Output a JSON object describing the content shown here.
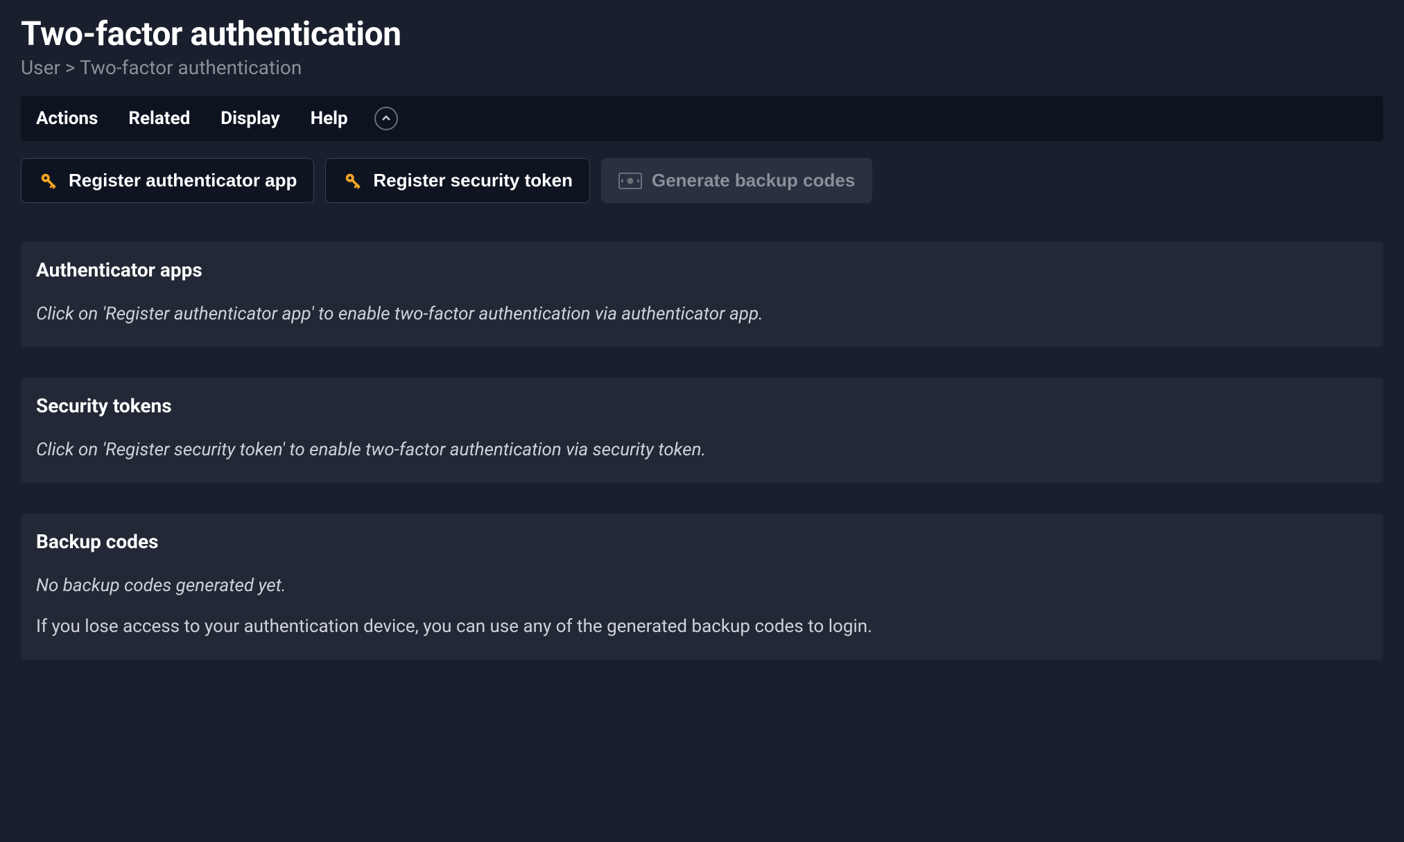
{
  "header": {
    "title": "Two-factor authentication",
    "breadcrumb_parent": "User",
    "breadcrumb_sep": " > ",
    "breadcrumb_current": "Two-factor authentication"
  },
  "menubar": {
    "items": [
      "Actions",
      "Related",
      "Display",
      "Help"
    ]
  },
  "actions": {
    "register_app": "Register authenticator app",
    "register_token": "Register security token",
    "generate_backup": "Generate backup codes"
  },
  "panels": {
    "authenticator": {
      "title": "Authenticator apps",
      "body": "Click on 'Register authenticator app' to enable two-factor authentication via authenticator app."
    },
    "tokens": {
      "title": "Security tokens",
      "body": "Click on 'Register security token' to enable two-factor authentication via security token."
    },
    "backup": {
      "title": "Backup codes",
      "none": "No backup codes generated yet.",
      "info": "If you lose access to your authentication device, you can use any of the generated backup codes to login."
    }
  }
}
